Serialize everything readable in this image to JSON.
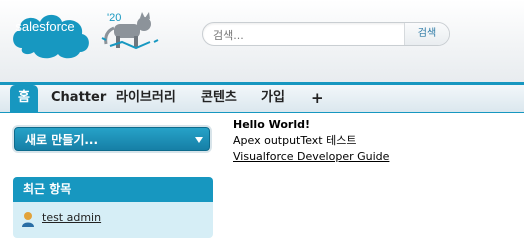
{
  "header": {
    "logo_text": "salesforce",
    "badge_text": "'20",
    "search": {
      "placeholder": "검색...",
      "button_label": "검색"
    }
  },
  "tabs": [
    {
      "label": "홈",
      "active": true
    },
    {
      "label": "Chatter",
      "active": false
    },
    {
      "label": "라이브러리",
      "active": false
    },
    {
      "label": "콘텐츠",
      "active": false
    },
    {
      "label": "가입",
      "active": false
    },
    {
      "label": "+",
      "active": false
    }
  ],
  "sidebar": {
    "new_button_label": "새로 만들기...",
    "recent": {
      "title": "최근 항목",
      "items": [
        {
          "label": "test admin",
          "icon": "user-icon"
        }
      ]
    }
  },
  "main": {
    "title": "Hello World!",
    "text": "Apex outputText 테스트",
    "link_text": "Visualforce Developer Guide"
  },
  "colors": {
    "accent": "#1797c0",
    "recent_bg": "#d6eef6"
  }
}
